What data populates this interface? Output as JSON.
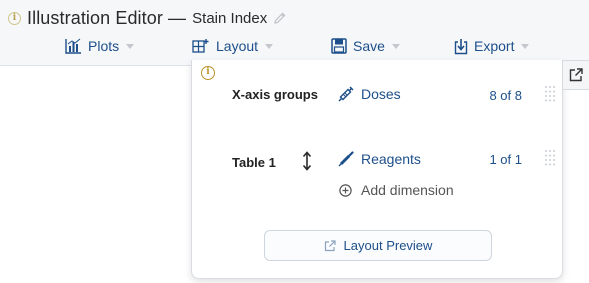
{
  "header": {
    "app_title": "Illustration Editor —",
    "document_name": "Stain Index"
  },
  "toolbar": {
    "plots_label": "Plots",
    "layout_label": "Layout",
    "save_label": "Save",
    "export_label": "Export"
  },
  "layout_panel": {
    "rows": [
      {
        "label": "X-axis groups",
        "dimension": "Doses",
        "count": "8 of 8"
      },
      {
        "label": "Table 1",
        "dimension": "Reagents",
        "count": "1 of 1"
      }
    ],
    "add_dimension_label": "Add dimension",
    "preview_label": "Layout Preview"
  },
  "colors": {
    "accent": "#1d4f8a",
    "header_bg": "#f6f7f9",
    "info": "#b8922a"
  },
  "icons": {
    "title_info": "info-icon",
    "edit": "pencil-icon",
    "plots": "plots-icon",
    "layout": "layout-grid-icon",
    "save": "floppy-disk-icon",
    "export": "export-icon",
    "doses": "syringe-icon",
    "reagents": "pipette-icon",
    "reorder": "vertical-arrows-icon",
    "grip": "drag-grip-icon",
    "add": "plus-circle-icon",
    "preview": "external-link-icon",
    "popout": "popout-icon"
  }
}
